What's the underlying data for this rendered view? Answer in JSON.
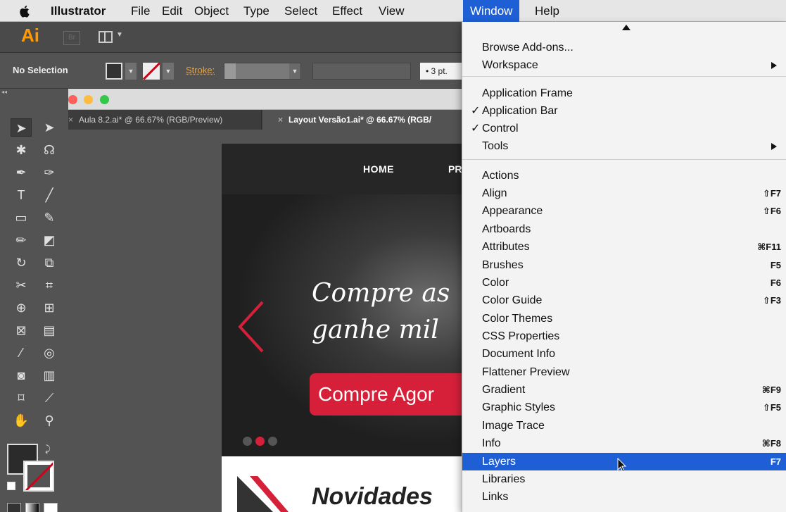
{
  "menubar": {
    "app_name": "Illustrator",
    "items": [
      "File",
      "Edit",
      "Object",
      "Type",
      "Select",
      "Effect",
      "View",
      "Window",
      "Help"
    ],
    "active_item": "Window"
  },
  "appbar": {
    "logo": "Ai",
    "bridge_logo": "Br"
  },
  "controlbar": {
    "selection_status": "No Selection",
    "stroke_label": "Stroke:",
    "stroke_weight": "• 3 pt."
  },
  "document": {
    "tabs": [
      {
        "label": "Aula 8.2.ai* @ 66.67% (RGB/Preview)",
        "close": "×"
      },
      {
        "label": "Layout Versão1.ai* @ 66.67% (RGB/",
        "close": "×",
        "active": true
      }
    ],
    "artboard": {
      "nav_home": "HOME",
      "nav_partial": "PR",
      "hero_line1": "Compre as",
      "hero_line2": "ganhe mil",
      "hero_button": "Compre Agor",
      "section_title": "Novidades",
      "accent_color": "#d6203a"
    }
  },
  "window_menu": {
    "items": [
      {
        "label": "Browse Add-ons...",
        "shortcut": "",
        "check": false,
        "submenu": false
      },
      {
        "label": "Workspace",
        "shortcut": "",
        "check": false,
        "submenu": true
      },
      {
        "label": "Application Frame",
        "shortcut": "",
        "check": false,
        "submenu": false
      },
      {
        "label": "Application Bar",
        "shortcut": "",
        "check": true,
        "submenu": false
      },
      {
        "label": "Control",
        "shortcut": "",
        "check": true,
        "submenu": false
      },
      {
        "label": "Tools",
        "shortcut": "",
        "check": false,
        "submenu": true
      },
      {
        "label": "Actions",
        "shortcut": "",
        "check": false,
        "submenu": false
      },
      {
        "label": "Align",
        "shortcut": "⇧F7",
        "check": false,
        "submenu": false
      },
      {
        "label": "Appearance",
        "shortcut": "⇧F6",
        "check": false,
        "submenu": false
      },
      {
        "label": "Artboards",
        "shortcut": "",
        "check": false,
        "submenu": false
      },
      {
        "label": "Attributes",
        "shortcut": "⌘F11",
        "check": false,
        "submenu": false
      },
      {
        "label": "Brushes",
        "shortcut": "F5",
        "check": false,
        "submenu": false
      },
      {
        "label": "Color",
        "shortcut": "F6",
        "check": false,
        "submenu": false
      },
      {
        "label": "Color Guide",
        "shortcut": "⇧F3",
        "check": false,
        "submenu": false
      },
      {
        "label": "Color Themes",
        "shortcut": "",
        "check": false,
        "submenu": false
      },
      {
        "label": "CSS Properties",
        "shortcut": "",
        "check": false,
        "submenu": false
      },
      {
        "label": "Document Info",
        "shortcut": "",
        "check": false,
        "submenu": false
      },
      {
        "label": "Flattener Preview",
        "shortcut": "",
        "check": false,
        "submenu": false
      },
      {
        "label": "Gradient",
        "shortcut": "⌘F9",
        "check": false,
        "submenu": false
      },
      {
        "label": "Graphic Styles",
        "shortcut": "⇧F5",
        "check": false,
        "submenu": false
      },
      {
        "label": "Image Trace",
        "shortcut": "",
        "check": false,
        "submenu": false
      },
      {
        "label": "Info",
        "shortcut": "⌘F8",
        "check": false,
        "submenu": false
      },
      {
        "label": "Layers",
        "shortcut": "F7",
        "check": false,
        "submenu": false,
        "highlighted": true
      },
      {
        "label": "Libraries",
        "shortcut": "",
        "check": false,
        "submenu": false
      },
      {
        "label": "Links",
        "shortcut": "",
        "check": false,
        "submenu": false
      }
    ],
    "check_glyph": "✓",
    "highlight_color": "#1e5fd6"
  }
}
